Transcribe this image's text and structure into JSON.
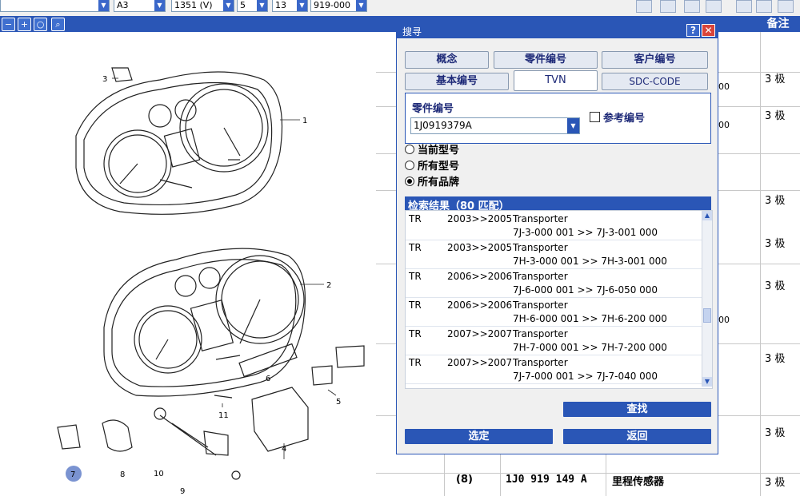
{
  "toolbar": {
    "combos": [
      "",
      "A3",
      "1351 (V)",
      "5",
      "13",
      "919-000"
    ]
  },
  "drawing": {
    "callouts": [
      "1",
      "2",
      "3",
      "5",
      "6",
      "7",
      "8",
      "9",
      "10",
      "11",
      "4"
    ]
  },
  "table": {
    "header_remarks": "备注",
    "remark_values": [
      "3 极",
      "3 极",
      "3 极",
      "3 极",
      "3 极",
      "3 极",
      "3 极",
      "3 极",
      "3 极"
    ],
    "partial_values": [
      "00",
      "00",
      "00"
    ],
    "last_row": {
      "pos": "(8)",
      "part_no": "1J0 919 149 A",
      "desc": "里程传感器",
      "remark": "3 极"
    }
  },
  "dialog": {
    "title": "搜寻",
    "help_label": "?",
    "close_label": "✕",
    "tabs": [
      "概念",
      "零件编号",
      "客户编号",
      "基本编号",
      "TVN",
      "SDC-CODE"
    ],
    "active_tab": "TVN",
    "field_label": "零件编号",
    "part_number_value": "1J0919379A",
    "reference_label": "参考编号",
    "radio_options": [
      "当前型号",
      "所有型号",
      "所有品牌"
    ],
    "radio_selected": "所有品牌",
    "results_header": "检索结果（80 匹配）",
    "results": [
      {
        "brand": "TR",
        "years": "2003>>2005",
        "model": "Transporter",
        "range": "7J-3-000 001 >> 7J-3-001 000"
      },
      {
        "brand": "TR",
        "years": "2003>>2005",
        "model": "Transporter",
        "range": "7H-3-000 001 >> 7H-3-001 000"
      },
      {
        "brand": "TR",
        "years": "2006>>2006",
        "model": "Transporter",
        "range": "7J-6-000 001 >> 7J-6-050 000"
      },
      {
        "brand": "TR",
        "years": "2006>>2006",
        "model": "Transporter",
        "range": "7H-6-000 001 >> 7H-6-200 000"
      },
      {
        "brand": "TR",
        "years": "2007>>2007",
        "model": "Transporter",
        "range": "7H-7-000 001 >> 7H-7-200 000"
      },
      {
        "brand": "TR",
        "years": "2007>>2007",
        "model": "Transporter",
        "range": "7J-7-000 001 >> 7J-7-040 000"
      }
    ],
    "search_button": "查找",
    "select_button": "选定",
    "back_button": "返回"
  },
  "colors": {
    "accent": "#2a56b6",
    "title_bar": "#2a56b6",
    "close_red": "#d9443a"
  }
}
